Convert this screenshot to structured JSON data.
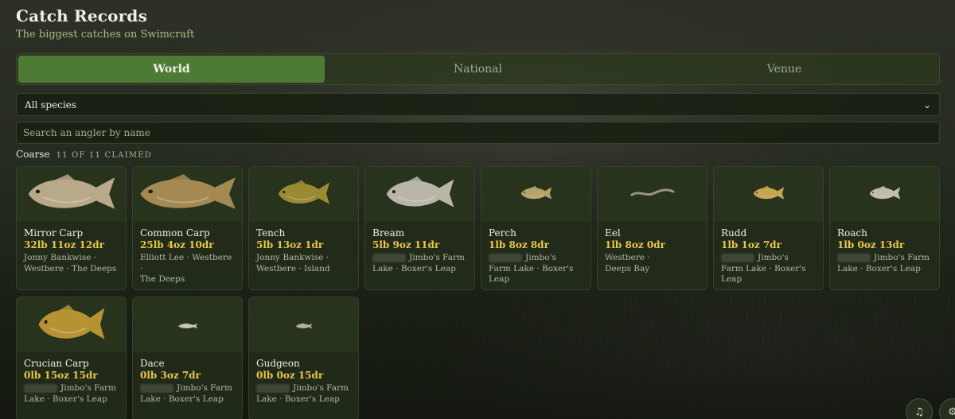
{
  "header": {
    "title": "Catch Records",
    "subtitle": "The biggest catches on Swimcraft"
  },
  "tabs": [
    {
      "label": "World",
      "active": true
    },
    {
      "label": "National",
      "active": false
    },
    {
      "label": "Venue",
      "active": false
    }
  ],
  "species_filter": {
    "selected": "All species"
  },
  "search": {
    "placeholder": "Search an angler by name",
    "value": ""
  },
  "section": {
    "title": "Coarse",
    "count": "11 OF 11 CLAIMED"
  },
  "records": [
    {
      "fish": "Mirror Carp",
      "weight": "32lb 11oz 12dr",
      "line1": "Jonny Bankwise ·",
      "line2": "Westbere · The Deeps",
      "line3": "",
      "icon": "mirror-carp-icon",
      "color": "#b8a98a"
    },
    {
      "fish": "Common Carp",
      "weight": "25lb 4oz 10dr",
      "line1": "Elliott Lee · Westbere ·",
      "line2": "The Deeps",
      "line3": "",
      "icon": "common-carp-icon",
      "color": "#a48a52"
    },
    {
      "fish": "Tench",
      "weight": "5lb 13oz 1dr",
      "line1": "Jonny Bankwise ·",
      "line2": "Westbere · Island",
      "line3": "",
      "icon": "tench-icon",
      "color": "#9a8a32"
    },
    {
      "fish": "Bream",
      "weight": "5lb 9oz 11dr",
      "line1": "Jimbo's Farm",
      "line2": "Lake · Boxer's Leap",
      "line3": "",
      "icon": "bream-icon",
      "color": "#b9b5a8"
    },
    {
      "fish": "Perch",
      "weight": "1lb 8oz 8dr",
      "line1": "Jimbo's",
      "line2": "Farm Lake · Boxer's",
      "line3": "Leap",
      "icon": "perch-icon",
      "color": "#b7a26a"
    },
    {
      "fish": "Eel",
      "weight": "1lb 8oz 0dr",
      "line1": "Westbere ·",
      "line2": "Deeps Bay",
      "line3": "",
      "icon": "eel-icon",
      "color": "#9a9478"
    },
    {
      "fish": "Rudd",
      "weight": "1lb 1oz 7dr",
      "line1": "Jimbo's",
      "line2": "Farm Lake · Boxer's",
      "line3": "Leap",
      "icon": "rudd-icon",
      "color": "#c7a454"
    },
    {
      "fish": "Roach",
      "weight": "1lb 0oz 13dr",
      "line1": "Jimbo's Farm",
      "line2": "Lake · Boxer's Leap",
      "line3": "",
      "icon": "roach-icon",
      "color": "#c2bcaa"
    },
    {
      "fish": "Crucian Carp",
      "weight": "0lb 15oz 15dr",
      "line1": "Jimbo's Farm",
      "line2": "Lake · Boxer's Leap",
      "line3": "",
      "icon": "crucian-carp-icon",
      "color": "#b59232"
    },
    {
      "fish": "Dace",
      "weight": "0lb 3oz 7dr",
      "line1": "Jimbo's Farm",
      "line2": "Lake · Boxer's Leap",
      "line3": "",
      "icon": "dace-icon",
      "color": "#c8c6ba"
    },
    {
      "fish": "Gudgeon",
      "weight": "0lb 0oz 15dr",
      "line1": "Jimbo's Farm",
      "line2": "Lake · Boxer's Leap",
      "line3": "",
      "icon": "gudgeon-icon",
      "color": "#b7b09a"
    }
  ],
  "corner_buttons": [
    {
      "icon": "music-note-icon"
    },
    {
      "icon": "settings-icon"
    }
  ]
}
